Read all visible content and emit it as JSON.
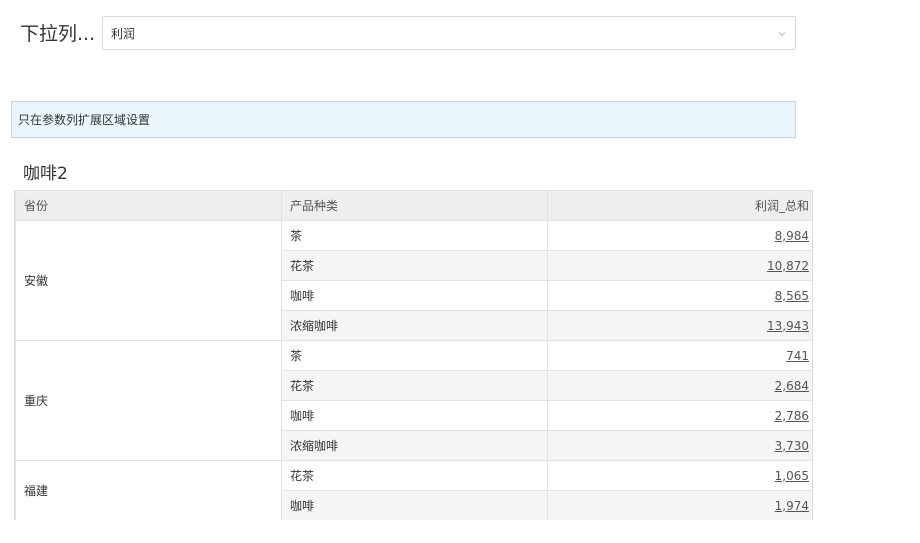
{
  "filter": {
    "label": "下拉列...",
    "selected": "利润"
  },
  "notice": {
    "text": "只在参数列扩展区域设置"
  },
  "table": {
    "title": "咖啡2",
    "headers": [
      "省份",
      "产品种类",
      "利润_总和"
    ],
    "groups": [
      {
        "province": "安徽",
        "rows": [
          {
            "category": "茶",
            "value": "8,984"
          },
          {
            "category": "花茶",
            "value": "10,872"
          },
          {
            "category": "咖啡",
            "value": "8,565"
          },
          {
            "category": "浓缩咖啡",
            "value": "13,943"
          }
        ]
      },
      {
        "province": "重庆",
        "rows": [
          {
            "category": "茶",
            "value": "741"
          },
          {
            "category": "花茶",
            "value": "2,684"
          },
          {
            "category": "咖啡",
            "value": "2,786"
          },
          {
            "category": "浓缩咖啡",
            "value": "3,730"
          }
        ]
      },
      {
        "province": "福建",
        "rows": [
          {
            "category": "花茶",
            "value": "1,065"
          },
          {
            "category": "咖啡",
            "value": "1,974"
          }
        ]
      }
    ]
  },
  "colors": {
    "notice_bg": "#ebf5fc",
    "header_bg": "#eeeeee",
    "stripe_bg": "#f5f5f5"
  },
  "icons": {
    "select_arrow": "chevron-down-icon"
  }
}
